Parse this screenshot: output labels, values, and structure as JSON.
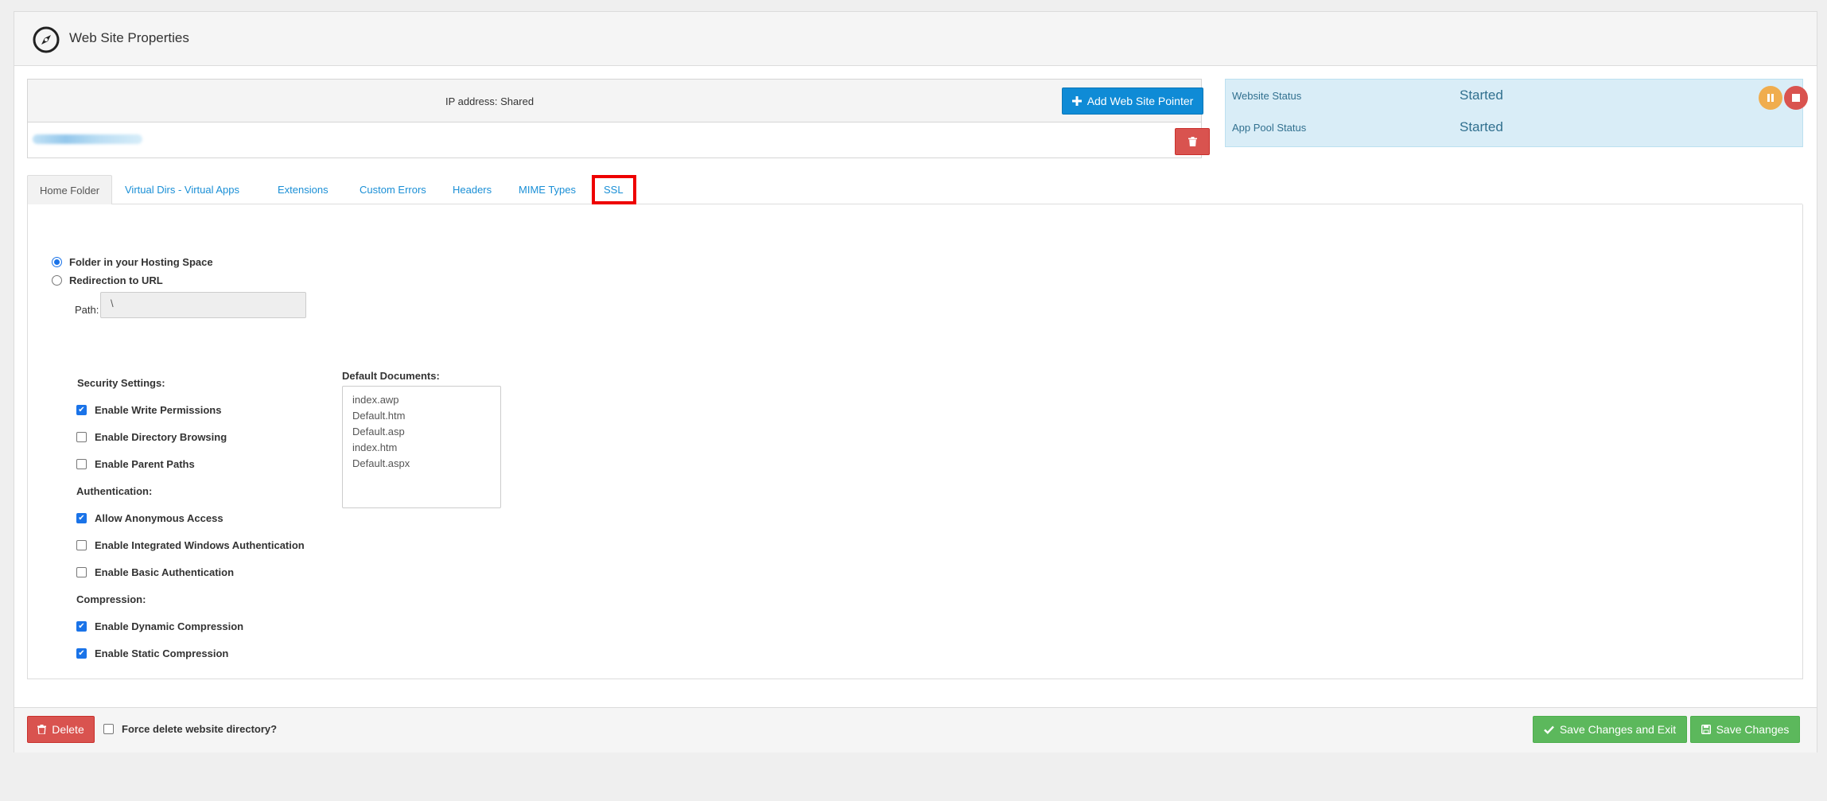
{
  "header": {
    "title": "Web Site Properties",
    "icon": "compass-icon"
  },
  "pointers": {
    "ip_label": "IP address: Shared",
    "add_pointer_label": "Add Web Site Pointer"
  },
  "status": {
    "website_label": "Website Status",
    "website_value": "Started",
    "app_pool_label": "App Pool Status",
    "app_pool_value": "Started"
  },
  "tabs": [
    {
      "label": "Home Folder",
      "active": true
    },
    {
      "label": "Virtual Dirs - Virtual Apps"
    },
    {
      "label": "Extensions"
    },
    {
      "label": "Custom Errors"
    },
    {
      "label": "Headers"
    },
    {
      "label": "MIME Types"
    },
    {
      "label": "SSL",
      "highlighted": true
    }
  ],
  "home_folder": {
    "option_folder": "Folder in your Hosting Space",
    "option_redirect": "Redirection to URL",
    "selected_option": "Folder in your Hosting Space",
    "path_label": "Path:",
    "path_value": "\\"
  },
  "security": {
    "heading": "Security Settings:",
    "items": [
      {
        "label": "Enable Write Permissions",
        "checked": true
      },
      {
        "label": "Enable Directory Browsing",
        "checked": false
      },
      {
        "label": "Enable Parent Paths",
        "checked": false
      }
    ]
  },
  "authentication": {
    "heading": "Authentication:",
    "items": [
      {
        "label": "Allow Anonymous Access",
        "checked": true
      },
      {
        "label": "Enable Integrated Windows Authentication",
        "checked": false
      },
      {
        "label": "Enable Basic Authentication",
        "checked": false
      }
    ]
  },
  "compression": {
    "heading": "Compression:",
    "items": [
      {
        "label": "Enable Dynamic Compression",
        "checked": true
      },
      {
        "label": "Enable Static Compression",
        "checked": true
      }
    ]
  },
  "default_documents": {
    "label": "Default Documents:",
    "items": [
      "index.awp",
      "Default.htm",
      "Default.asp",
      "index.htm",
      "Default.aspx"
    ]
  },
  "footer": {
    "delete_label": "Delete",
    "force_delete_label": "Force delete website directory?",
    "save_exit_label": "Save Changes and Exit",
    "save_label": "Save Changes"
  },
  "colors": {
    "primary": "#0f8bd6",
    "danger": "#d9534f",
    "success": "#5cb85c",
    "warning": "#f0ad4e",
    "info_bg": "#d9edf7",
    "highlight": "#ee0000"
  }
}
